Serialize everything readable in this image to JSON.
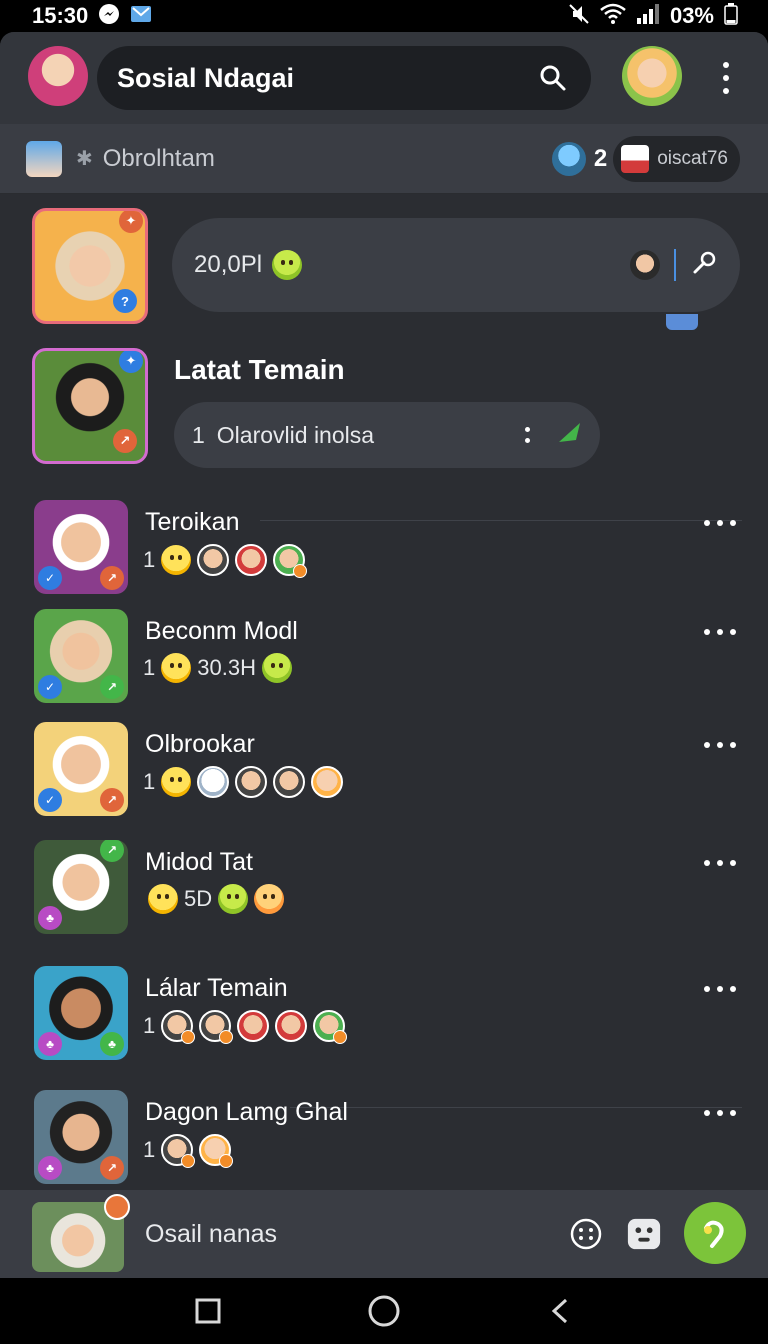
{
  "status": {
    "time": "15:30",
    "battery": "03%"
  },
  "header": {
    "title": "Sosial Ndagai"
  },
  "subheader": {
    "label": "Obrolhtam",
    "count": "2",
    "pill_text": "oiscat76"
  },
  "featured": {
    "bubble_text": "20,0Pl",
    "section_title": "Latat Temain",
    "second_bubble_num": "1",
    "second_bubble_text": "Olarovlid inolsa"
  },
  "chats": [
    {
      "name": "Teroikan",
      "count": "1",
      "stat": ""
    },
    {
      "name": "Beconm Modl",
      "count": "1",
      "stat": "30.3H"
    },
    {
      "name": "Olbrookar",
      "count": "1",
      "stat": ""
    },
    {
      "name": "Midod Tat",
      "count": "",
      "stat": "5D"
    },
    {
      "name": "Lálar Temain",
      "count": "1",
      "stat": ""
    },
    {
      "name": "Dagon Lamg Ghal",
      "count": "1",
      "stat": ""
    }
  ],
  "composer": {
    "placeholder": "Osail nanas"
  },
  "colors": {
    "accent": "#7cc43a",
    "background": "#2b2d32",
    "bar": "#33363c"
  },
  "icons": [
    "search-icon",
    "more-vertical-icon",
    "star-icon",
    "mic-icon",
    "check-icon",
    "emoji-icon",
    "sticker-icon",
    "send-icon",
    "nav-recent-icon",
    "nav-home-icon",
    "nav-back-icon"
  ]
}
